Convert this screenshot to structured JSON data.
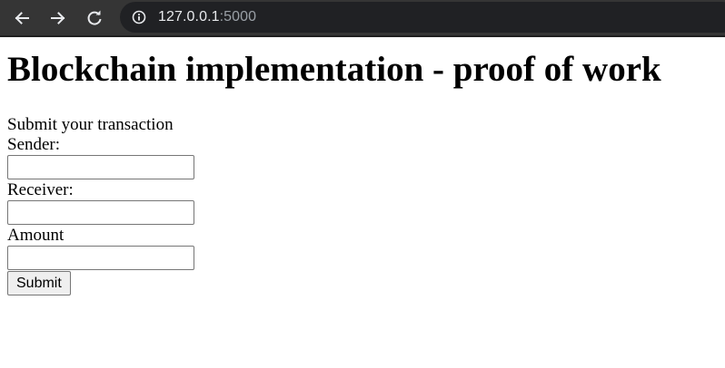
{
  "browser": {
    "icons": {
      "back": "arrow-left-icon",
      "forward": "arrow-right-icon",
      "reload": "reload-icon",
      "info": "info-icon"
    },
    "url": {
      "host": "127.0.0.1",
      "port": ":5000"
    },
    "colors": {
      "toolbar": "#353535",
      "omnibox": "#202124",
      "icon": "#e8eaed"
    }
  },
  "page": {
    "title": "Blockchain implementation - proof of work",
    "form": {
      "heading": "Submit your transaction",
      "sender_label": "Sender:",
      "sender_value": "",
      "receiver_label": "Receiver:",
      "receiver_value": "",
      "amount_label": "Amount",
      "amount_value": "",
      "submit_label": "Submit"
    }
  }
}
